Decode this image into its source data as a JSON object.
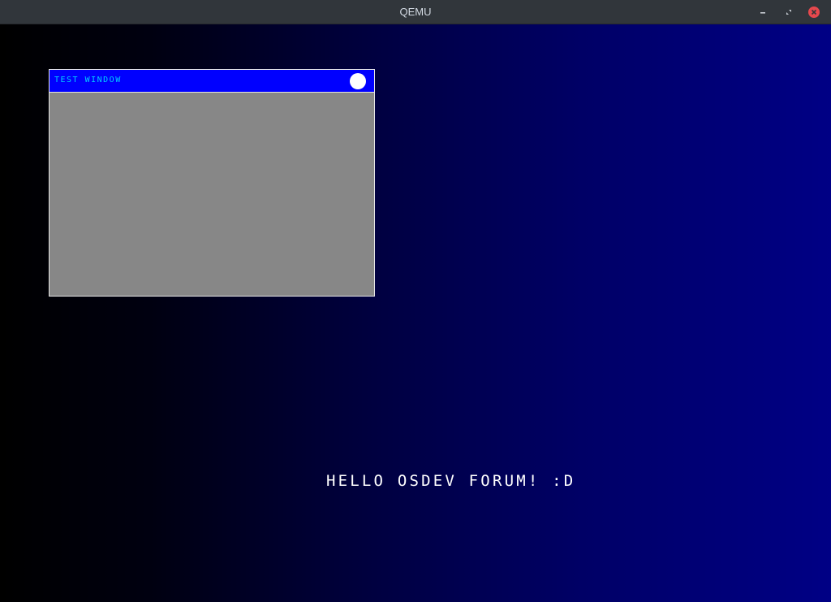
{
  "app": {
    "window_title": "QEMU"
  },
  "titlebar": {
    "buttons": [
      {
        "name": "minimize",
        "icon": "minimize-icon"
      },
      {
        "name": "restore",
        "icon": "restore-icon"
      },
      {
        "name": "close",
        "icon": "close-icon",
        "color": "#e5484d"
      }
    ]
  },
  "guest": {
    "desktop_gradient": [
      "#000000",
      "#000085"
    ],
    "window": {
      "title": "TEST WINDOW",
      "title_color": "#00d0ff",
      "titlebar_color": "#0000ff",
      "body_color": "#878787",
      "close_icon": "circle-close-icon"
    },
    "message": "HELLO OSDEV FORUM! :D"
  }
}
